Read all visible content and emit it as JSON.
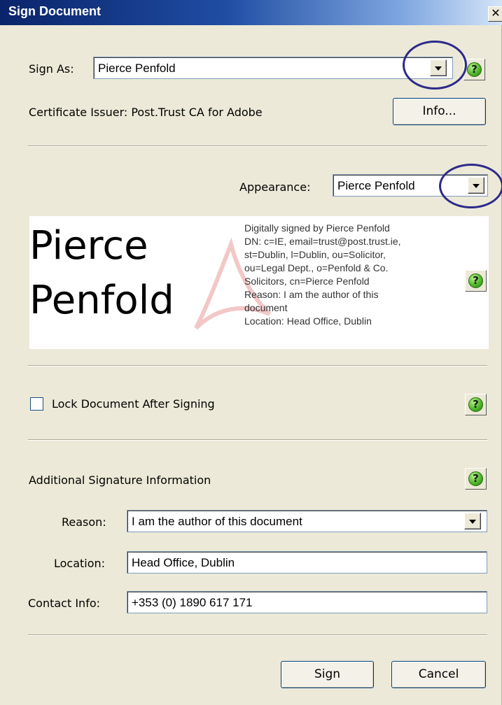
{
  "window": {
    "title": "Sign Document",
    "close_glyph": "✕"
  },
  "sign_as": {
    "label": "Sign As:",
    "value": "Pierce Penfold"
  },
  "certificate": {
    "issuer_text": "Certificate Issuer: Post.Trust CA for Adobe",
    "info_button": {
      "text": "Info...",
      "mnemonic": "n"
    }
  },
  "appearance": {
    "label": "Appearance:",
    "value": "Pierce Penfold"
  },
  "preview": {
    "name_lines": [
      "Pierce",
      "Penfold"
    ],
    "detail_lines": [
      "Digitally signed by Pierce Penfold",
      "DN: c=IE, email=trust@post.trust.ie,",
      "st=Dublin, l=Dublin, ou=Solicitor,",
      "ou=Legal Dept., o=Penfold & Co.",
      "Solicitors, cn=Pierce Penfold",
      "Reason: I am the author of this",
      "document",
      "Location: Head Office, Dublin"
    ]
  },
  "lock": {
    "label": "Lock Document After Signing",
    "checked": false
  },
  "additional": {
    "heading": "Additional Signature Information",
    "reason": {
      "label": "Reason:",
      "value": "I am the author of this document"
    },
    "location": {
      "label": "Location:",
      "value": "Head Office, Dublin"
    },
    "contact": {
      "label": "Contact Info:",
      "value": "+353 (0) 1890 617 171"
    }
  },
  "buttons": {
    "sign": "Sign",
    "cancel": "Cancel"
  },
  "help_glyph": "?",
  "colors": {
    "title_gradient_start": "#0a246a",
    "title_gradient_end": "#d4e4f7",
    "dialog_bg": "#ece9d8",
    "annotation_circle": "#2c2a8a",
    "help_icon": "#4fb82a"
  }
}
